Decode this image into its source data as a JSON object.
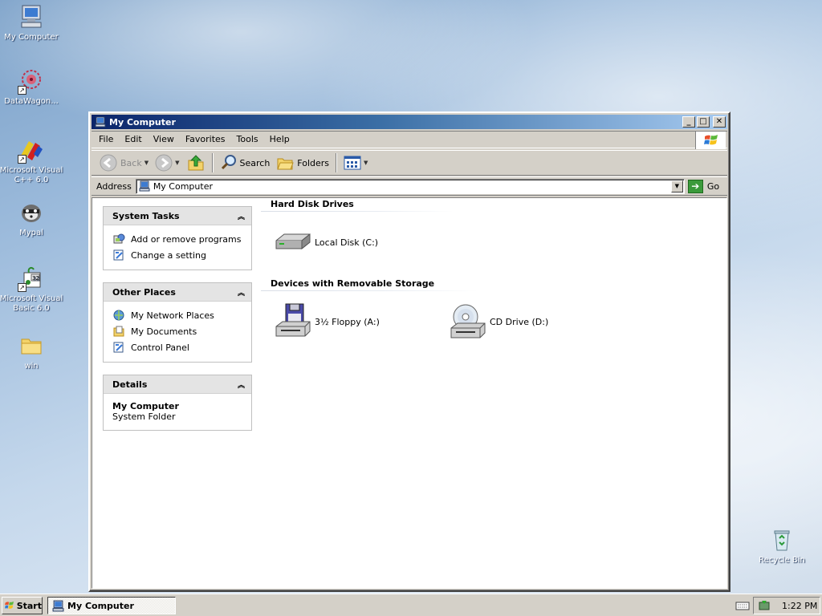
{
  "desktop": {
    "icons": [
      {
        "label": "My Computer",
        "icon": "my-computer-icon"
      },
      {
        "label": "DataWagon...",
        "icon": "datawagon-icon"
      },
      {
        "label": "Microsoft Visual C++ 6.0",
        "icon": "visual-cpp-icon"
      },
      {
        "label": "Mypal",
        "icon": "mypal-icon"
      },
      {
        "label": "Microsoft Visual Basic 6.0",
        "icon": "visual-basic-icon"
      },
      {
        "label": "win",
        "icon": "folder-icon"
      },
      {
        "label": "Recycle Bin",
        "icon": "recycle-bin-icon"
      }
    ]
  },
  "window": {
    "title": "My Computer",
    "menu": [
      "File",
      "Edit",
      "View",
      "Favorites",
      "Tools",
      "Help"
    ],
    "toolbar": {
      "back": "Back",
      "search": "Search",
      "folders": "Folders"
    },
    "address": {
      "label": "Address",
      "value": "My Computer",
      "go": "Go"
    }
  },
  "taskpane": {
    "system_tasks": {
      "title": "System Tasks",
      "items": [
        "Add or remove programs",
        "Change a setting"
      ]
    },
    "other_places": {
      "title": "Other Places",
      "items": [
        "My Network Places",
        "My Documents",
        "Control Panel"
      ]
    },
    "details": {
      "title": "Details",
      "name": "My Computer",
      "type": "System Folder"
    }
  },
  "main": {
    "hard_disk_title": "Hard Disk Drives",
    "hard_disks": [
      "Local Disk (C:)"
    ],
    "removable_title": "Devices with Removable Storage",
    "removable": [
      "3½ Floppy (A:)",
      "CD Drive (D:)"
    ]
  },
  "taskbar": {
    "start": "Start",
    "active_task": "My Computer",
    "clock": "1:22 PM"
  }
}
